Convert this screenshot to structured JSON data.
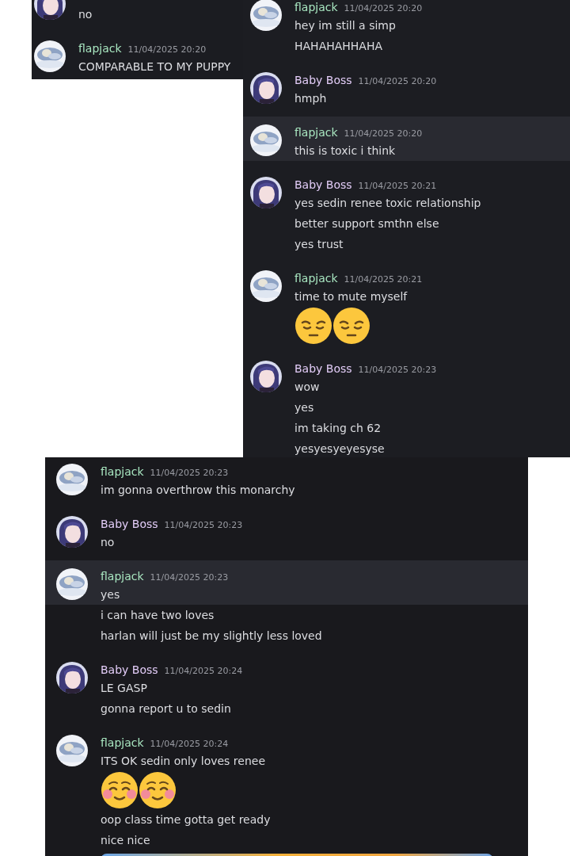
{
  "panels": [
    {
      "messages": [
        {
          "kind": "hair",
          "highlighted": false,
          "lines": [
            {
              "kind": "text",
              "text": "no"
            }
          ]
        },
        {
          "author": "flapjack",
          "color": "#a8e6c0",
          "time": "11/04/2025 20:20",
          "kind": "cloud",
          "highlighted": false,
          "lines": [
            {
              "kind": "text",
              "text": "COMPARABLE TO MY PUPPY"
            }
          ]
        }
      ]
    },
    {
      "messages": [
        {
          "author": "flapjack",
          "color": "#a8e6c0",
          "time": "11/04/2025 20:20",
          "kind": "cloud",
          "highlighted": false,
          "lines": [
            {
              "kind": "text",
              "text": "hey im still a simp"
            },
            {
              "kind": "text",
              "text": "HAHAHAHHAHA"
            }
          ]
        },
        {
          "author": "Baby Boss",
          "color": "#e2ccf7",
          "time": "11/04/2025 20:20",
          "kind": "hair",
          "highlighted": false,
          "lines": [
            {
              "kind": "text",
              "text": "hmph"
            }
          ]
        },
        {
          "author": "flapjack",
          "color": "#a8e6c0",
          "time": "11/04/2025 20:20",
          "kind": "cloud",
          "highlighted": true,
          "lines": [
            {
              "kind": "text",
              "text": "this is toxic i think"
            }
          ]
        },
        {
          "author": "Baby Boss",
          "color": "#e2ccf7",
          "time": "11/04/2025 20:21",
          "kind": "hair",
          "highlighted": false,
          "lines": [
            {
              "kind": "text",
              "text": "yes sedin renee toxic relationship"
            },
            {
              "kind": "text",
              "text": "better support smthn else"
            },
            {
              "kind": "text",
              "text": "yes trust"
            }
          ]
        },
        {
          "author": "flapjack",
          "color": "#a8e6c0",
          "time": "11/04/2025 20:21",
          "kind": "cloud",
          "highlighted": false,
          "lines": [
            {
              "kind": "text",
              "text": "time to mute myself"
            },
            {
              "kind": "emojis",
              "items": [
                {
                  "kind": "pensive"
                },
                {
                  "kind": "pensive"
                }
              ]
            }
          ]
        },
        {
          "author": "Baby Boss",
          "color": "#e2ccf7",
          "time": "11/04/2025 20:23",
          "kind": "hair",
          "highlighted": false,
          "lines": [
            {
              "kind": "text",
              "text": "wow"
            },
            {
              "kind": "text",
              "text": "yes"
            },
            {
              "kind": "text",
              "text": "im taking ch 62"
            },
            {
              "kind": "text",
              "text": "yesyesyeyesyse"
            }
          ]
        }
      ]
    },
    {
      "messages": [
        {
          "author": "flapjack",
          "color": "#a8e6c0",
          "time": "11/04/2025 20:23",
          "kind": "cloud",
          "highlighted": false,
          "lines": [
            {
              "kind": "text",
              "text": "im gonna overthrow this monarchy"
            }
          ]
        },
        {
          "author": "Baby Boss",
          "color": "#e2ccf7",
          "time": "11/04/2025 20:23",
          "kind": "hair",
          "highlighted": false,
          "lines": [
            {
              "kind": "text",
              "text": "no"
            }
          ]
        },
        {
          "author": "flapjack",
          "color": "#a8e6c0",
          "time": "11/04/2025 20:23",
          "kind": "cloud",
          "highlighted": true,
          "lines": [
            {
              "kind": "text",
              "text": "yes"
            },
            {
              "kind": "text",
              "text": "i can have two loves"
            },
            {
              "kind": "text",
              "text": "harlan will just be my slightly less loved"
            }
          ]
        },
        {
          "author": "Baby Boss",
          "color": "#e2ccf7",
          "time": "11/04/2025 20:24",
          "kind": "hair",
          "highlighted": false,
          "lines": [
            {
              "kind": "text",
              "text": "LE GASP"
            },
            {
              "kind": "text",
              "text": "gonna report u to sedin"
            }
          ]
        },
        {
          "author": "flapjack",
          "color": "#a8e6c0",
          "time": "11/04/2025 20:24",
          "kind": "cloud",
          "highlighted": false,
          "lines": [
            {
              "kind": "text",
              "text": "ITS OK sedin only loves renee"
            },
            {
              "kind": "emojis",
              "items": [
                {
                  "kind": "blush"
                },
                {
                  "kind": "blush"
                }
              ]
            },
            {
              "kind": "text",
              "text": "oop class time gotta get ready"
            },
            {
              "kind": "text",
              "text": "nice nice"
            },
            {
              "kind": "picture"
            }
          ]
        }
      ]
    }
  ]
}
